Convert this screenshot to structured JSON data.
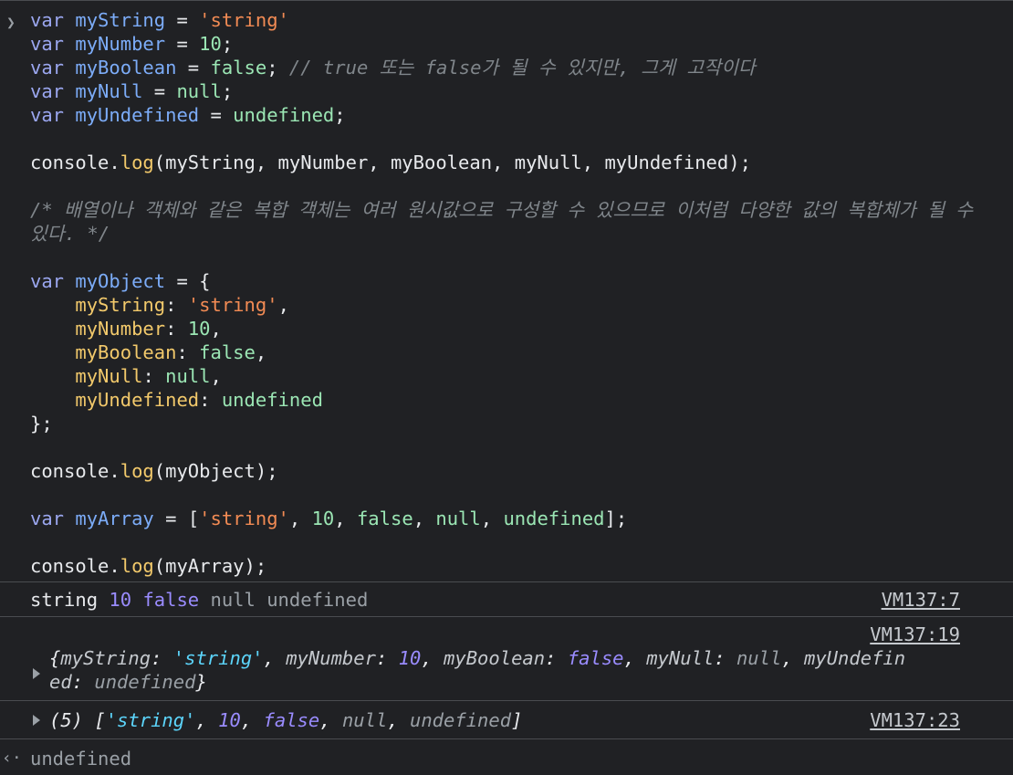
{
  "input": {
    "prompt_icon": "chevron-right-icon",
    "lines": {
      "l1": {
        "kw": "var",
        "name": "myString",
        "eq": " = ",
        "val": "'string'"
      },
      "l2": {
        "kw": "var",
        "name": "myNumber",
        "eq": " = ",
        "val": "10",
        "end": ";"
      },
      "l3": {
        "kw": "var",
        "name": "myBoolean",
        "eq": " = ",
        "val": "false",
        "end": "; ",
        "comment": "// true 또는 false가 될 수 있지만, 그게 고작이다"
      },
      "l4": {
        "kw": "var",
        "name": "myNull",
        "eq": " = ",
        "val": "null",
        "end": ";"
      },
      "l5": {
        "kw": "var",
        "name": "myUndefined",
        "eq": " = ",
        "val": "undefined",
        "end": ";"
      },
      "l6": {
        "obj": "console",
        "dot": ".",
        "fn": "log",
        "args": "(myString, myNumber, myBoolean, myNull, myUndefined);"
      },
      "l7": {
        "comment": "/* 배열이나 객체와 같은 복합 객체는 여러 원시값으로 구성할 수 있으므로 이처럼 다양한 값의 복합체가 될 수 있다. */"
      },
      "l8": {
        "kw": "var",
        "name": "myObject",
        "eq": " = ",
        "open": "{"
      },
      "p1": {
        "key": "myString",
        "sep": ": ",
        "val": "'string'",
        "end": ","
      },
      "p2": {
        "key": "myNumber",
        "sep": ": ",
        "val": "10",
        "end": ","
      },
      "p3": {
        "key": "myBoolean",
        "sep": ": ",
        "val": "false",
        "end": ","
      },
      "p4": {
        "key": "myNull",
        "sep": ": ",
        "val": "null",
        "end": ","
      },
      "p5": {
        "key": "myUndefined",
        "sep": ": ",
        "val": "undefined"
      },
      "l9": {
        "close": "};"
      },
      "l10": {
        "obj": "console",
        "dot": ".",
        "fn": "log",
        "args": "(myObject);"
      },
      "l11": {
        "kw": "var",
        "name": "myArray",
        "eq": " = ",
        "open": "[",
        "s": "'string'",
        "c1": ", ",
        "n": "10",
        "c2": ", ",
        "b": "false",
        "c3": ", ",
        "nl": "null",
        "c4": ", ",
        "u": "undefined",
        "close": "];"
      },
      "l12": {
        "obj": "console",
        "dot": ".",
        "fn": "log",
        "args": "(myArray);"
      }
    }
  },
  "outputs": {
    "m1": {
      "text": "string",
      "num": "10",
      "bool": "false",
      "nul": "null",
      "und": "undefined",
      "source": "VM137:7"
    },
    "m2": {
      "source": "VM137:19",
      "expand_icon": "triangle-right-icon",
      "open": "{",
      "k1": "myString",
      "v1": "'string'",
      "k2": "myNumber",
      "v2": "10",
      "k3": "myBoolean",
      "v3": "false",
      "k4": "myNull",
      "v4": "null",
      "k5a": "myUndefin",
      "k5b": "ed",
      "v5": "undefined",
      "close": "}"
    },
    "m3": {
      "source": "VM137:23",
      "expand_icon": "triangle-right-icon",
      "len": "(5) ",
      "open": "[",
      "v1": "'string'",
      "v2": "10",
      "v3": "false",
      "v4": "null",
      "v5": "undefined",
      "close": "]"
    },
    "ret": {
      "icon": "return-arrow-icon",
      "value": "undefined"
    }
  }
}
